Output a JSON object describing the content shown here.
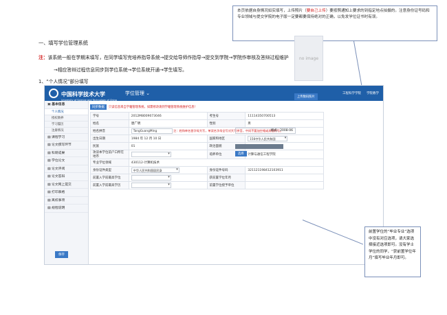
{
  "top_note": {
    "part1": "本页依据自身情况如实填写，上传照片（",
    "highlight": "要自己上传",
    "part2": "）要按照通知上要求的到指定地点拍摄的。注意身份证号码和专业领域与提交学院的电子版一定要都要保持绝对的正确，以免发学位证书时有误。"
  },
  "section_title": "一、填写学位管理系统",
  "note_label": "注：",
  "note_line1": "该系统一般在学期末填写，在同学填写完培养指导系统→提交给导师作指导→提交到学院→学院作审核及答辩过程维护",
  "note_line2": "→相应答辩过程信息同步到学位系统→学位系统开通→学生填写。",
  "subsection_title": "1、“个人情况”部分填写",
  "app": {
    "logo_text": "中国科学技术大学",
    "logo_sub": "University of Science and Technology of China",
    "system_name": "学位管理 ⌄",
    "top_links": [
      "工程科学学院",
      "学院教学"
    ]
  },
  "sidebar": {
    "items": [
      {
        "label": "▣ 基本信息",
        "type": "head"
      },
      {
        "label": "个人情况",
        "type": "sub-active"
      },
      {
        "label": "授权教养",
        "type": "sub"
      },
      {
        "label": "学习履历",
        "type": "sub"
      },
      {
        "label": "注册情况",
        "type": "sub"
      },
      {
        "label": "▤ 课程学习",
        "type": "item"
      },
      {
        "label": "▤ 论文撰写环节",
        "type": "item"
      },
      {
        "label": "▤ 科研成果",
        "type": "item"
      },
      {
        "label": "▤ 学位论文",
        "type": "item"
      },
      {
        "label": "▤ 论文评阅",
        "type": "item"
      },
      {
        "label": "▤ 论文答辩",
        "type": "item"
      },
      {
        "label": "▤ 论文网上提交",
        "type": "item"
      },
      {
        "label": "▤ 打印表格",
        "type": "item"
      },
      {
        "label": "▤ 离校事项",
        "type": "item"
      },
      {
        "label": "▤ 规程说明",
        "type": "item"
      }
    ]
  },
  "tab": "同步数据",
  "tab_note": "只读信息来自学籍管理系统，如需修改请到学籍管理系统维护信息！",
  "form": {
    "xuehao_label": "学号",
    "xuehao": "2012M8009073046",
    "kaosheng_label": "考生号",
    "kaosheng": "11114350700513",
    "name_label": "姓名",
    "name": "唐广明",
    "gender_label": "性别",
    "gender": "男",
    "pinyin_label": "姓名拼音",
    "pinyin": "TangGuangMing",
    "pinyin_hint": "注：姓和单名首字母大写，单双名字母全写对大写拼音，中间不要加空格或其他符号。",
    "birth_label": "出生日期",
    "birth": "1984 年 12 月 10 日",
    "country_label": "国家和地区",
    "country": "156中华人民共和国",
    "ethnic_label": "民族",
    "ethnic": "01",
    "political_label": "政治面貌",
    "political": "",
    "hukou_label": "攻读本学位前户口所在地市",
    "hukou": "",
    "unit_label": "培养单位",
    "unit": "计算与通信工程学院",
    "field_label": "专业学位领域",
    "field": "430112-计算机技术",
    "idtype_label": "身份证件类型",
    "idtype": "中华人民共和国居民身",
    "idno_label": "身份证件号码",
    "idno": "321121198412103911",
    "prev_school_label": "前置入学前最高学位",
    "prev_date_label": "获前置学位年月",
    "prev_date": "格式：2008-06",
    "prev_major_label": "前置入学前最高学历",
    "prev_edu_label": "前置学位授予单位"
  },
  "photo_text": "no image",
  "upload_button": "上传数码照片",
  "pick_button": "选择",
  "save_button": "保存",
  "callout": "前置学位的“毕业专业”选项中没有对应选项，请大家选择接近选项即可。没有学士学位的同学，“获前置学位年月”填写毕业年月即可。"
}
